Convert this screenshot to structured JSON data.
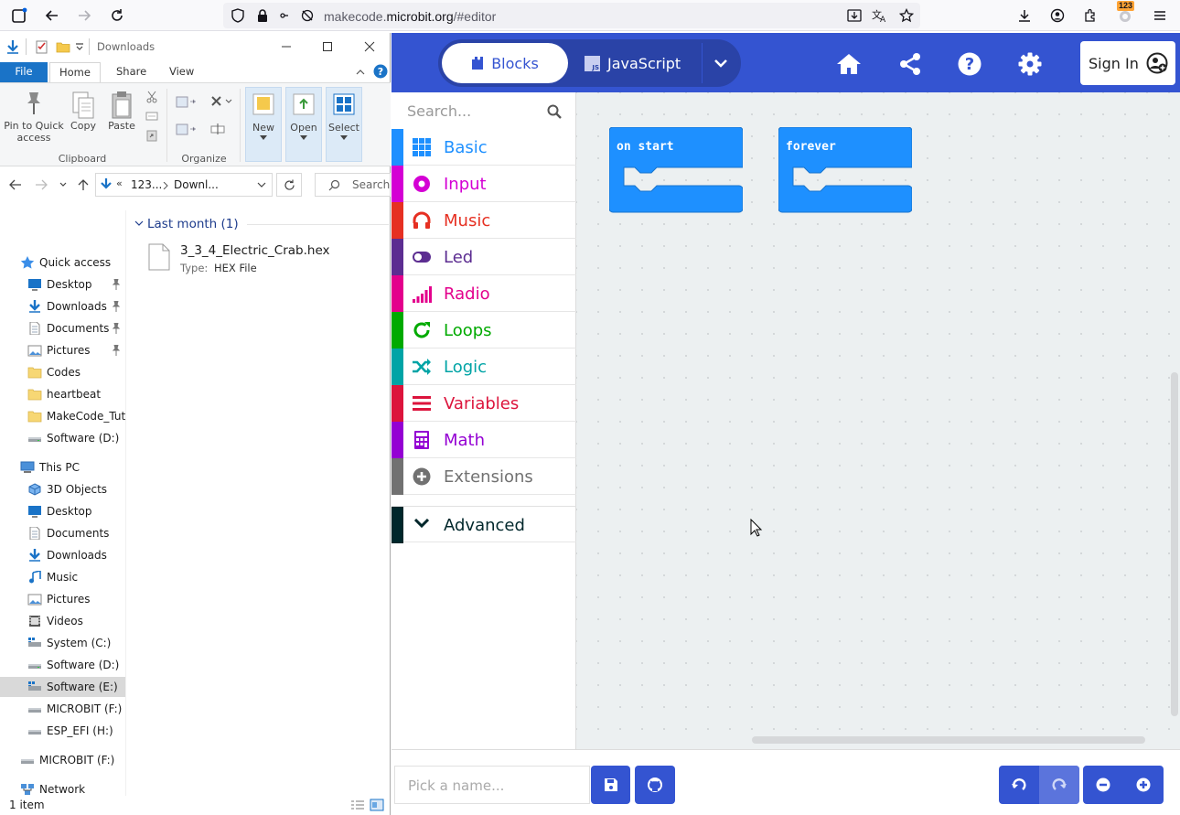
{
  "browser": {
    "url_prefix": "makecode.",
    "url_domain": "microbit.org",
    "url_suffix": "/#editor",
    "notif_badge": "123",
    "colors": {
      "toolbar_bg": "#f9f9fb",
      "urlbar_bg": "#f0f0f4"
    }
  },
  "explorer": {
    "window_title": "Downloads",
    "tabs": [
      "File",
      "Home",
      "Share",
      "View"
    ],
    "ribbon": {
      "pin_label": "Pin to Quick access",
      "copy_label": "Copy",
      "paste_label": "Paste",
      "clipboard_group": "Clipboard",
      "organize_group": "Organize",
      "new_label": "New",
      "open_label": "Open",
      "select_label": "Select"
    },
    "address": {
      "chev": "«",
      "part1": "123...",
      "part2": "Downl..."
    },
    "search_placeholder": "Search D",
    "nav": {
      "quick_access": "Quick access",
      "qa_items": [
        "Desktop",
        "Downloads",
        "Documents",
        "Pictures",
        "Codes",
        "heartbeat",
        "MakeCode_Tuto",
        "Software (D:)"
      ],
      "this_pc": "This PC",
      "pc_items": [
        "3D Objects",
        "Desktop",
        "Documents",
        "Downloads",
        "Music",
        "Pictures",
        "Videos",
        "System (C:)",
        "Software (D:)",
        "Software (E:)",
        "MICROBIT (F:)",
        "ESP_EFI (H:)"
      ],
      "microbit_root": "MICROBIT (F:)",
      "network": "Network"
    },
    "group_header": "Last month (1)",
    "file": {
      "name": "3_3_4_Electric_Crab.hex",
      "type_label": "Type:",
      "type_value": "HEX File"
    },
    "status": "1 item"
  },
  "makecode": {
    "colors": {
      "header": "#3454d1",
      "toggle_bg": "#2a43a7",
      "block": "#1e90ff"
    },
    "tabs": {
      "blocks": "Blocks",
      "javascript": "JavaScript"
    },
    "js_badge": "JS",
    "sign_in": "Sign In",
    "search_placeholder": "Search...",
    "categories": [
      {
        "label": "Basic",
        "color": "#1e90ff",
        "icon": "grid-icon"
      },
      {
        "label": "Input",
        "color": "#d400d4",
        "icon": "target-icon"
      },
      {
        "label": "Music",
        "color": "#e63022",
        "icon": "headphones-icon"
      },
      {
        "label": "Led",
        "color": "#5c2d91",
        "icon": "toggle-icon"
      },
      {
        "label": "Radio",
        "color": "#e3008c",
        "icon": "signal-icon"
      },
      {
        "label": "Loops",
        "color": "#00aa00",
        "icon": "loop-icon"
      },
      {
        "label": "Logic",
        "color": "#00a4a6",
        "icon": "shuffle-icon"
      },
      {
        "label": "Variables",
        "color": "#dc143c",
        "icon": "lines-icon"
      },
      {
        "label": "Math",
        "color": "#9400d3",
        "icon": "calculator-icon"
      },
      {
        "label": "Extensions",
        "color": "#717171",
        "icon": "plus-circle-icon"
      }
    ],
    "advanced": "Advanced",
    "advanced_color": "#00272b",
    "blocks": [
      "on start",
      "forever"
    ],
    "project_name_placeholder": "Pick a name..."
  }
}
